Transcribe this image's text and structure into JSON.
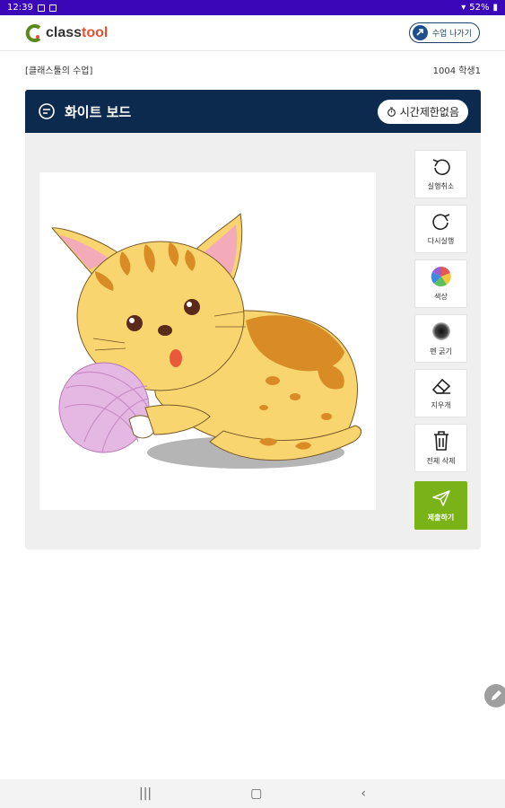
{
  "status": {
    "time": "12:39",
    "battery": "52%"
  },
  "app": {
    "logo_prefix": "class",
    "logo_suffix": "tool",
    "exit_label": "수업 나가기"
  },
  "meta": {
    "class_name": "[클래스툴의 수업]",
    "student": "1004 학생1"
  },
  "panel": {
    "title": "화이트 보드",
    "timer_label": "시간제한없음"
  },
  "tools": [
    {
      "label": "실행취소",
      "icon": "undo-icon"
    },
    {
      "label": "다시실행",
      "icon": "redo-icon"
    },
    {
      "label": "색상",
      "icon": "color-palette-icon"
    },
    {
      "label": "펜 굵기",
      "icon": "pen-thickness-icon"
    },
    {
      "label": "지우개",
      "icon": "eraser-icon"
    },
    {
      "label": "전체 삭제",
      "icon": "trash-icon"
    }
  ],
  "submit_label": "제출하기",
  "colors": {
    "header": "#0c2a4e",
    "submit": "#7ab318",
    "statusbar": "#3a06b8"
  }
}
